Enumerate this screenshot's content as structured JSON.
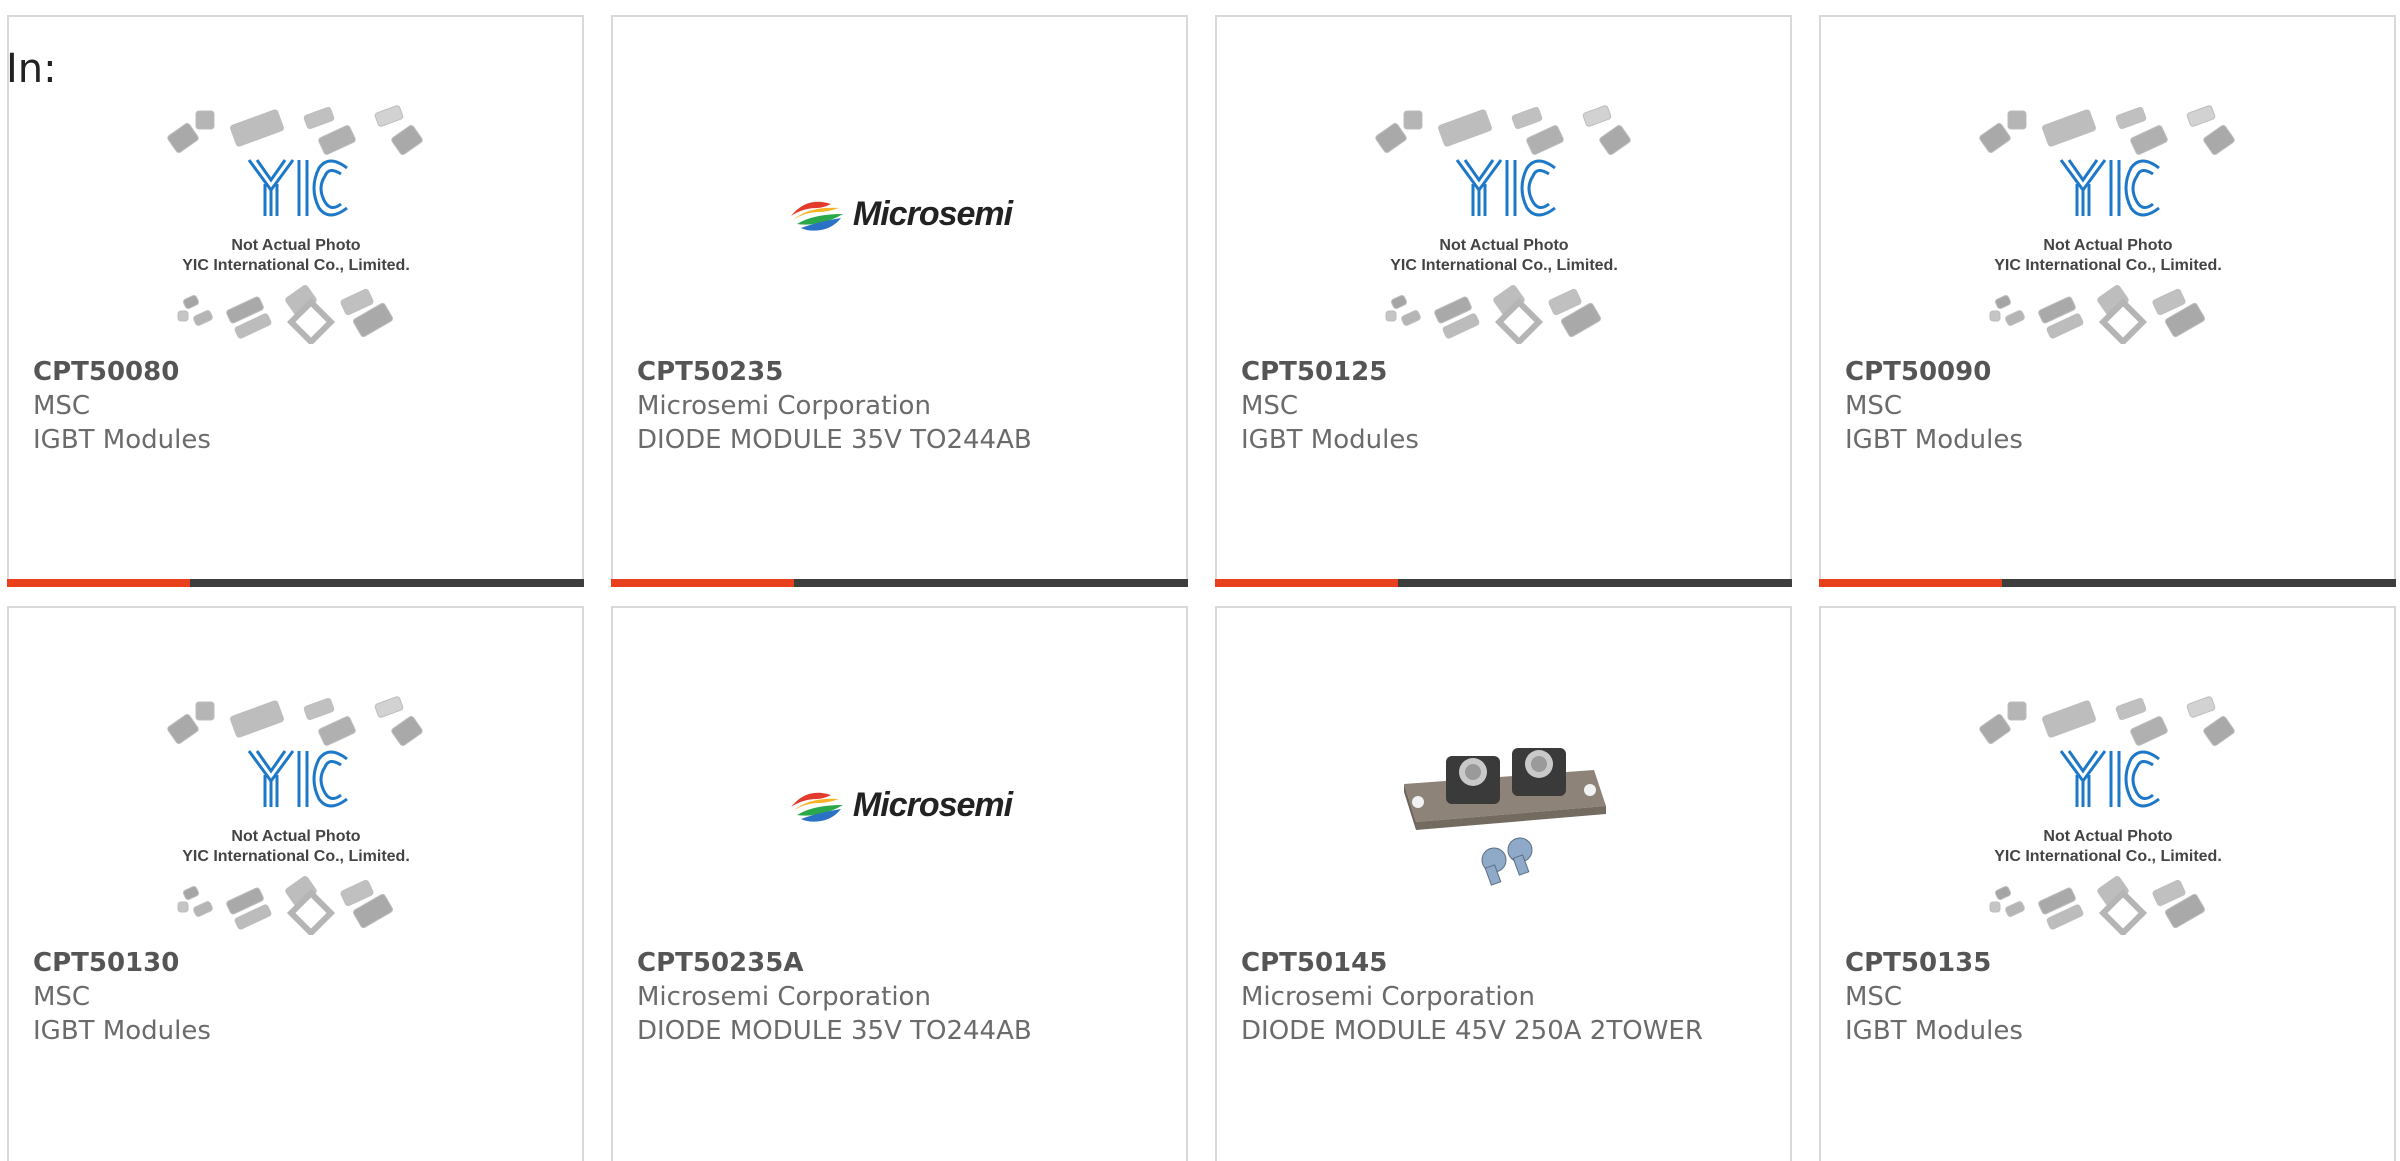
{
  "filter_label": "In:",
  "colors": {
    "accent": "#e8401c",
    "bar": "#3d3d3d",
    "card_border": "#d9d9d9",
    "text": "#6b6b6b"
  },
  "placeholder_text": {
    "line1": "Not Actual Photo",
    "line2": "YIC International Co., Limited."
  },
  "brand_logo_text": "Microsemi",
  "products": [
    {
      "part_number": "CPT50080",
      "manufacturer": "MSC",
      "description": "IGBT Modules",
      "image": "yic-placeholder-icon"
    },
    {
      "part_number": "CPT50235",
      "manufacturer": "Microsemi Corporation",
      "description": "DIODE MODULE 35V TO244AB",
      "image": "microsemi-logo-icon"
    },
    {
      "part_number": "CPT50125",
      "manufacturer": "MSC",
      "description": "IGBT Modules",
      "image": "yic-placeholder-icon"
    },
    {
      "part_number": "CPT50090",
      "manufacturer": "MSC",
      "description": "IGBT Modules",
      "image": "yic-placeholder-icon"
    },
    {
      "part_number": "CPT50130",
      "manufacturer": "MSC",
      "description": "IGBT Modules",
      "image": "yic-placeholder-icon"
    },
    {
      "part_number": "CPT50235A",
      "manufacturer": "Microsemi Corporation",
      "description": "DIODE MODULE 35V TO244AB",
      "image": "microsemi-logo-icon"
    },
    {
      "part_number": "CPT50145",
      "manufacturer": "Microsemi Corporation",
      "description": "DIODE MODULE 45V 250A 2TOWER",
      "image": "diode-module-photo-icon"
    },
    {
      "part_number": "CPT50135",
      "manufacturer": "MSC",
      "description": "IGBT Modules",
      "image": "yic-placeholder-icon"
    }
  ]
}
